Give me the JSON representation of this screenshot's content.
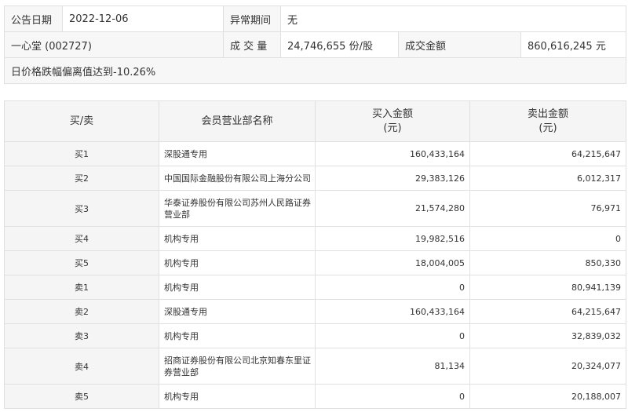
{
  "info": {
    "announce_date_label": "公告日期",
    "announce_date": "2022-12-06",
    "abnormal_period_label": "异常期间",
    "abnormal_period": "无",
    "stock": "一心堂 (002727)",
    "volume_label": "成 交 量",
    "volume": "24,746,655 份/股",
    "amount_label": "成交金额",
    "amount": "860,616,245 元",
    "reason": "日价格跌幅偏离值达到-10.26%"
  },
  "table": {
    "headers": {
      "side": "买/卖",
      "branch": "会员营业部名称",
      "buy_line1": "买入金额",
      "buy_line2": "(元)",
      "sell_line1": "卖出金额",
      "sell_line2": "(元)"
    },
    "rows": [
      {
        "side": "买1",
        "branch": "深股通专用",
        "buy": "160,433,164",
        "sell": "64,215,647"
      },
      {
        "side": "买2",
        "branch": "中国国际金融股份有限公司上海分公司",
        "buy": "29,383,126",
        "sell": "6,012,317"
      },
      {
        "side": "买3",
        "branch": "华泰证券股份有限公司苏州人民路证券营业部",
        "buy": "21,574,280",
        "sell": "76,971"
      },
      {
        "side": "买4",
        "branch": "机构专用",
        "buy": "19,982,516",
        "sell": "0"
      },
      {
        "side": "买5",
        "branch": "机构专用",
        "buy": "18,004,005",
        "sell": "850,330"
      },
      {
        "side": "卖1",
        "branch": "机构专用",
        "buy": "0",
        "sell": "80,941,139"
      },
      {
        "side": "卖2",
        "branch": "深股通专用",
        "buy": "160,433,164",
        "sell": "64,215,647"
      },
      {
        "side": "卖3",
        "branch": "机构专用",
        "buy": "0",
        "sell": "32,839,032"
      },
      {
        "side": "卖4",
        "branch": "招商证券股份有限公司北京知春东里证券营业部",
        "buy": "81,134",
        "sell": "20,324,077"
      },
      {
        "side": "卖5",
        "branch": "机构专用",
        "buy": "0",
        "sell": "20,188,007"
      }
    ]
  }
}
